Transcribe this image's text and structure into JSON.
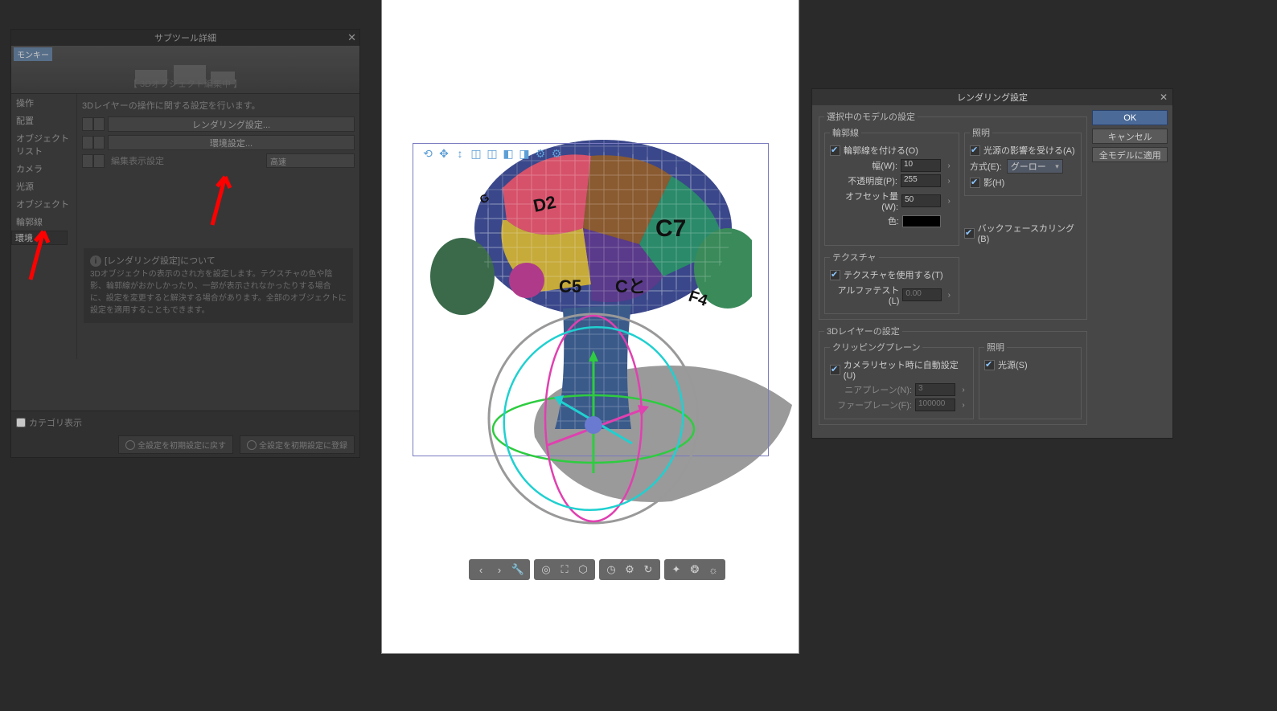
{
  "subtool": {
    "title": "サブツール詳細",
    "tag": "モンキー",
    "header_text": "【 3Dオブジェクト編集中 】",
    "cats": [
      "操作",
      "配置",
      "オブジェクトリスト",
      "カメラ",
      "光源",
      "オブジェクト",
      "輪郭線",
      "環境"
    ],
    "desc": "3Dレイヤーの操作に関する設定を行います。",
    "rendering_btn": "レンダリング設定...",
    "manage_btn": "環境設定...",
    "edit_display": "編集表示設定",
    "quality_sel": "高速",
    "help_title": "[レンダリング設定]について",
    "help_body": "3Dオブジェクトの表示のされ方を設定します。テクスチャの色や陰影、輪郭線がおかしかったり、一部が表示されなかったりする場合に、設定を変更すると解決する場合があります。全部のオブジェクトに設定を適用することもできます。",
    "cat_cb": "カテゴリ表示",
    "footer_reset": "全設定を初期設定に戻す",
    "footer_save": "全設定を初期設定に登録"
  },
  "rs": {
    "title": "レンダリング設定",
    "ok": "OK",
    "cancel": "キャンセル",
    "apply_all": "全モデルに適用",
    "model_fs": "選択中のモデルの設定",
    "outline_fs": "輪郭線",
    "outline_enable": "輪郭線を付ける(O)",
    "width_lbl": "幅(W):",
    "width_val": "10",
    "opacity_lbl": "不透明度(P):",
    "opacity_val": "255",
    "offset_lbl": "オフセット量(W):",
    "offset_val": "50",
    "color_lbl": "色:",
    "light_fs": "照明",
    "light_enable": "光源の影響を受ける(A)",
    "method_lbl": "方式(E):",
    "method_val": "グーロー",
    "shadow_cb": "影(H)",
    "bfcull": "バックフェースカリング(B)",
    "tex_fs": "テクスチャ",
    "tex_use": "テクスチャを使用する(T)",
    "alpha_lbl": "アルファテスト(L)",
    "alpha_val": "0.00",
    "layer_fs": "3Dレイヤーの設定",
    "clip_fs": "クリッピングプレーン",
    "auto_cb": "カメラリセット時に自動設定(U)",
    "near_lbl": "ニアプレーン(N):",
    "near_val": "3",
    "far_lbl": "ファープレーン(F):",
    "far_val": "100000",
    "light2_fs": "照明",
    "light_s": "光源(S)"
  }
}
